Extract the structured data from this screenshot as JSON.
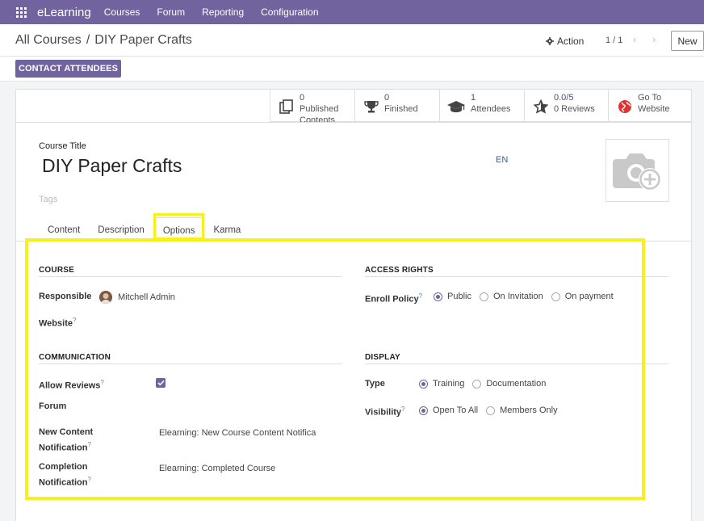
{
  "navbar": {
    "brand": "eLearning",
    "menu": [
      "Courses",
      "Forum",
      "Reporting",
      "Configuration"
    ]
  },
  "control": {
    "breadcrumb_root": "All Courses",
    "breadcrumb_sep": "/",
    "breadcrumb_current": "DIY Paper Crafts",
    "action_label": "Action",
    "pager": "1 / 1",
    "pager_arrows": "‹ ›",
    "new_label": "New"
  },
  "contact_button": "CONTACT ATTENDEES",
  "stats": [
    {
      "icon": "published-contents-icon",
      "count": "0",
      "label": "Published",
      "label2": "Contents"
    },
    {
      "icon": "trophy-icon",
      "count": "0",
      "label": "Finished",
      "label2": ""
    },
    {
      "icon": "graduation-cap-icon",
      "count": "1",
      "label": "Attendees",
      "label2": ""
    },
    {
      "icon": "star-icon",
      "count": "0.0/5",
      "label": "0 Reviews",
      "label2": ""
    },
    {
      "icon": "globe-icon",
      "count": "Go To",
      "label": "Website",
      "label2": ""
    }
  ],
  "form": {
    "title_label": "Course Title",
    "title": "DIY Paper Crafts",
    "lang": "EN",
    "tags_placeholder": "Tags"
  },
  "tabs": [
    "Content",
    "Description",
    "Options",
    "Karma"
  ],
  "sections": {
    "course": "COURSE",
    "access": "ACCESS RIGHTS",
    "communication": "COMMUNICATION",
    "display": "DISPLAY"
  },
  "fields": {
    "responsible_label": "Responsible",
    "responsible_value": "Mitchell Admin",
    "website_label": "Website",
    "enroll_label": "Enroll Policy",
    "enroll_options": [
      "Public",
      "On Invitation",
      "On payment"
    ],
    "enroll_selected": "Public",
    "allow_reviews_label": "Allow Reviews",
    "allow_reviews_checked": true,
    "forum_label": "Forum",
    "new_content_label_1": "New Content",
    "new_content_label_2": "Notification",
    "new_content_value": "Elearning: New Course Content Notifica",
    "completion_label_1": "Completion",
    "completion_label_2": "Notification",
    "completion_value": "Elearning: Completed Course",
    "type_label": "Type",
    "type_options": [
      "Training",
      "Documentation"
    ],
    "type_selected": "Training",
    "visibility_label": "Visibility",
    "visibility_options": [
      "Open To All",
      "Members Only"
    ],
    "visibility_selected": "Open To All",
    "help_mark": "?"
  },
  "colors": {
    "brand": "#71639e",
    "highlight": "#f7f01c"
  }
}
